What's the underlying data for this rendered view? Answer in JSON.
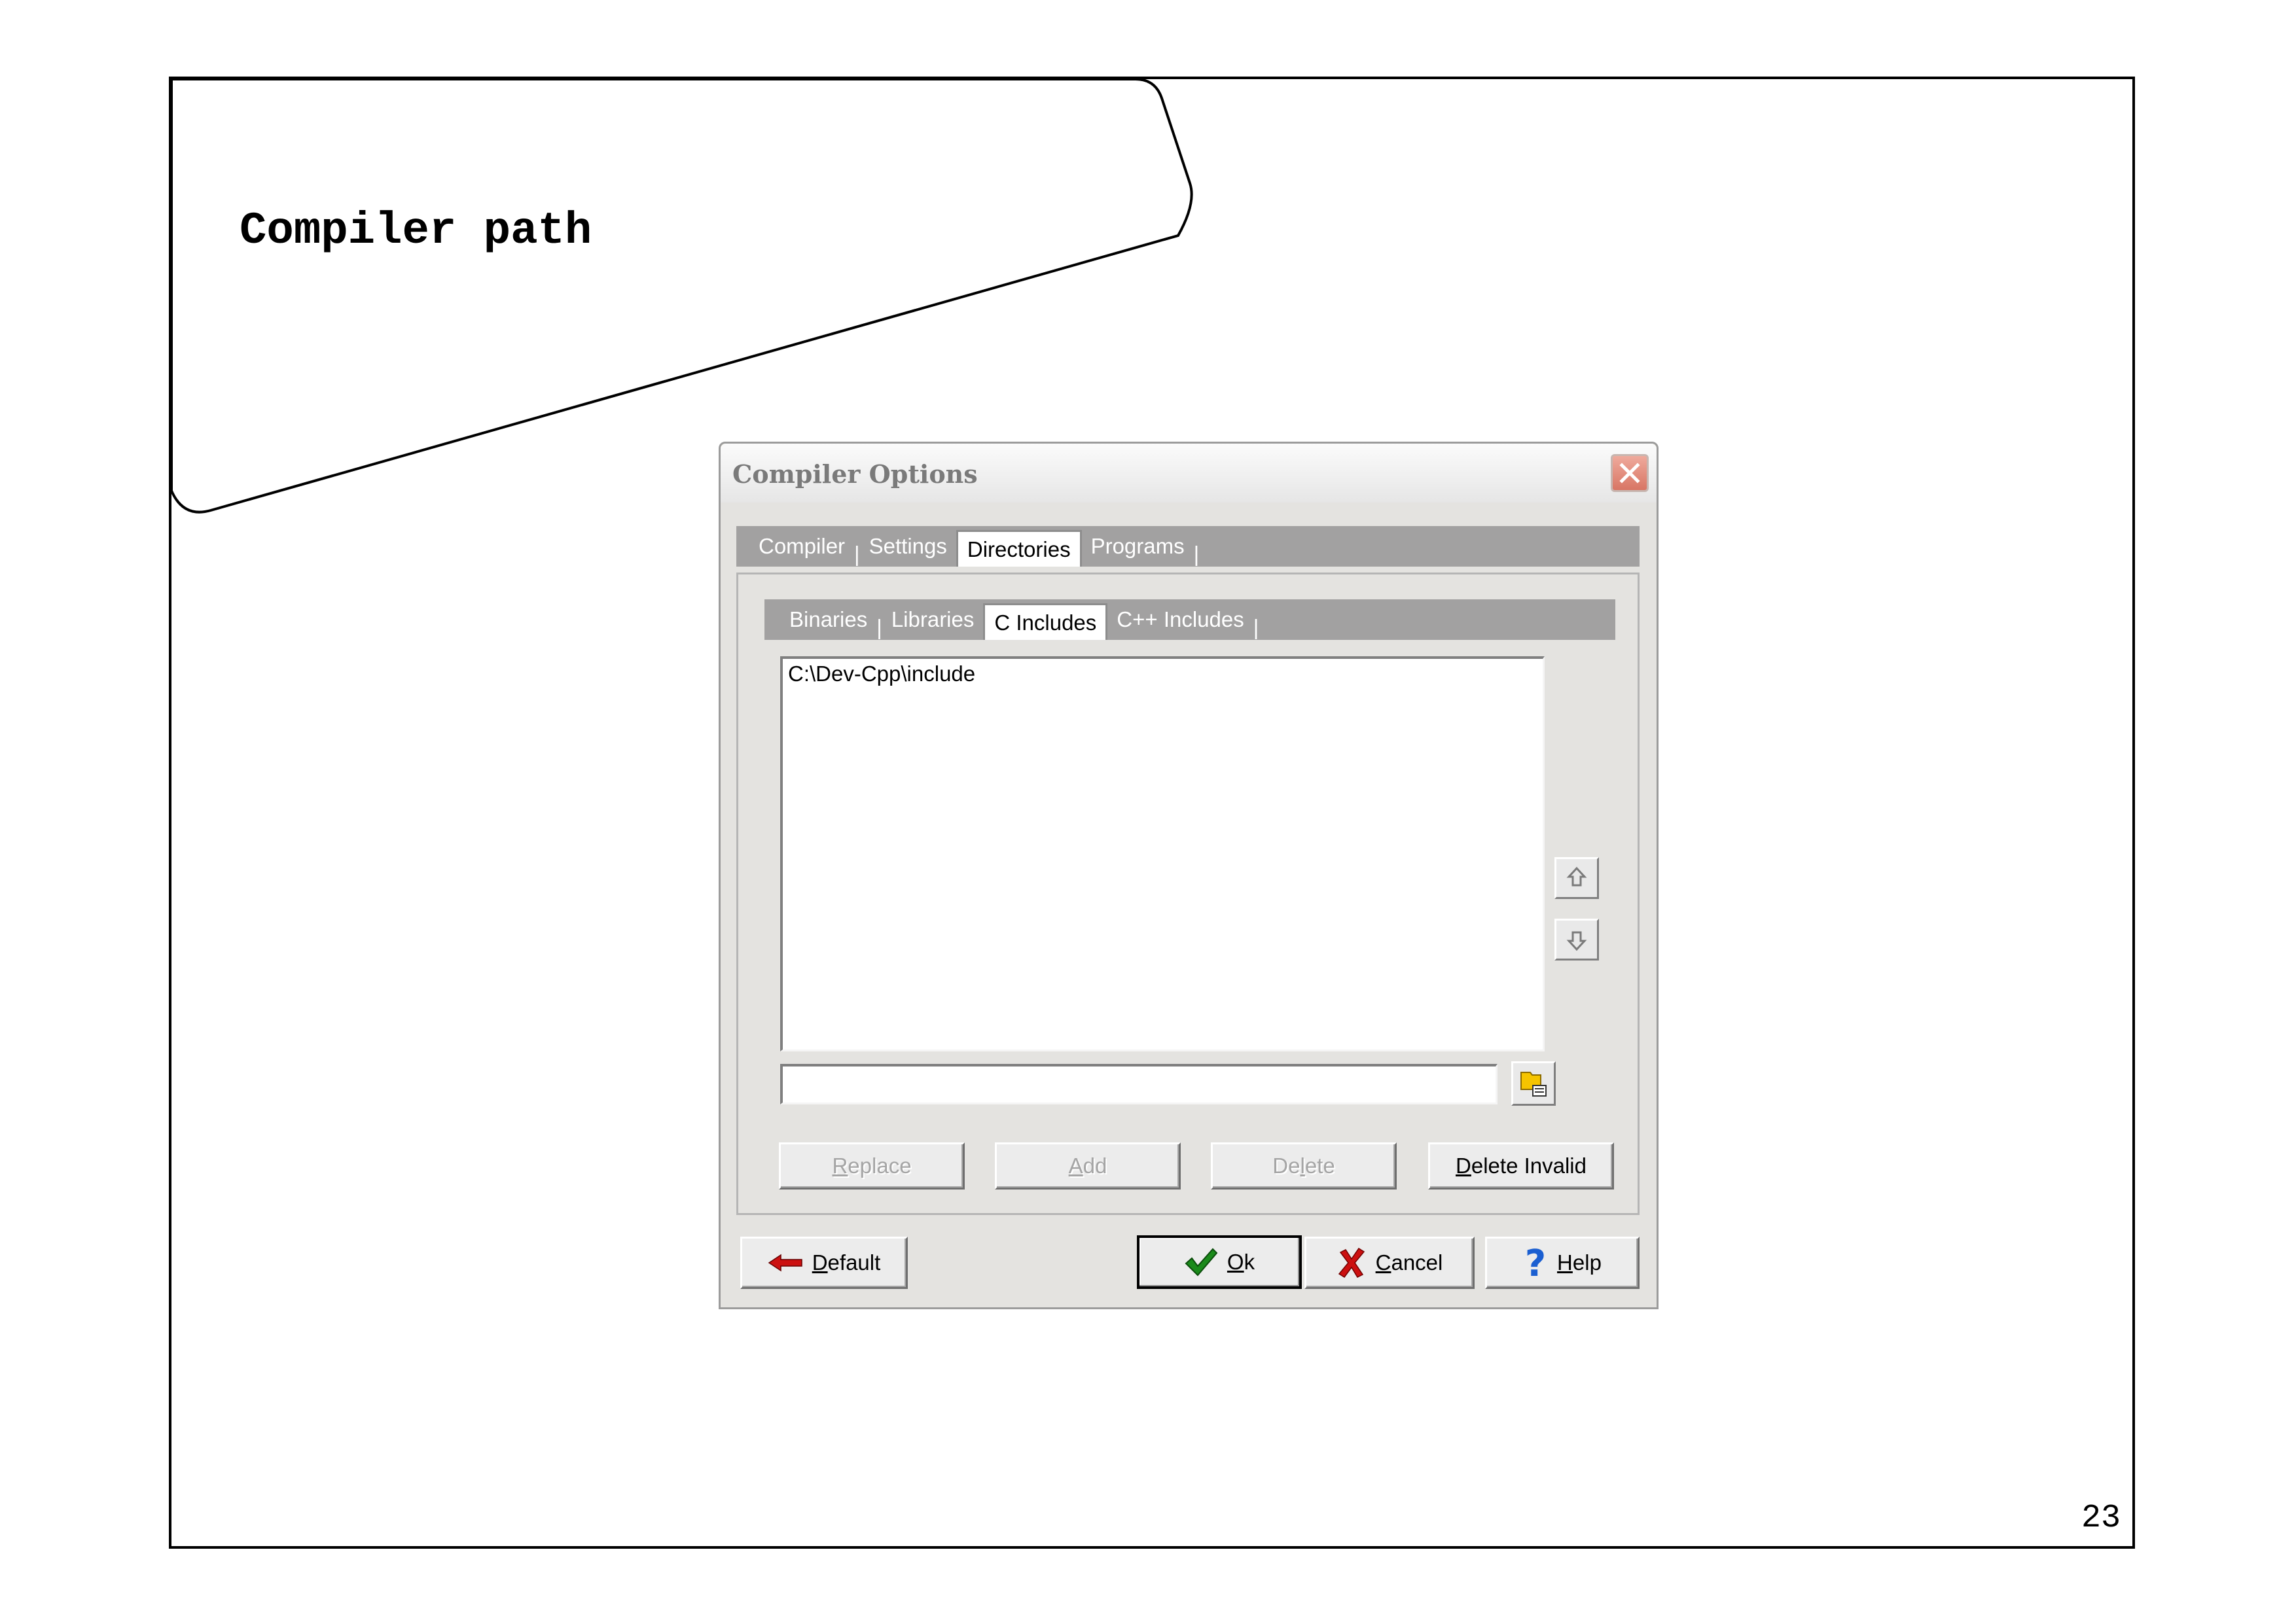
{
  "slide": {
    "title": "Compiler path",
    "page_number": "23"
  },
  "dialog": {
    "title": "Compiler Options",
    "main_tabs": [
      {
        "label": "Compiler"
      },
      {
        "label": "Settings"
      },
      {
        "label": "Directories",
        "active": true
      },
      {
        "label": "Programs"
      }
    ],
    "sub_tabs": [
      {
        "label": "Binaries"
      },
      {
        "label": "Libraries"
      },
      {
        "label": "C Includes",
        "active": true
      },
      {
        "label": "C++ Includes"
      }
    ],
    "directory_list": [
      "C:\\Dev-Cpp\\include"
    ],
    "path_input": {
      "value": "",
      "placeholder": ""
    },
    "buttons": {
      "replace": {
        "pre": "",
        "key": "R",
        "post": "eplace",
        "enabled": false
      },
      "add": {
        "pre": "",
        "key": "A",
        "post": "dd",
        "enabled": false
      },
      "delete": {
        "pre": "De",
        "key": "l",
        "post": "ete",
        "enabled": false
      },
      "delete_invalid": {
        "pre": "",
        "key": "D",
        "post": "elete Invalid",
        "enabled": true
      },
      "default": {
        "pre": "",
        "key": "D",
        "post": "efault"
      },
      "ok": {
        "pre": "",
        "key": "O",
        "post": "k"
      },
      "cancel": {
        "pre": "",
        "key": "C",
        "post": "ancel"
      },
      "help": {
        "pre": "",
        "key": "H",
        "post": "elp"
      }
    },
    "icons": {
      "close": "close-icon",
      "move_up": "arrow-up-icon",
      "move_down": "arrow-down-icon",
      "browse": "folder-browse-icon",
      "default": "red-arrow-left-icon",
      "ok": "green-check-icon",
      "cancel": "red-x-icon",
      "help": "blue-question-icon"
    }
  },
  "colors": {
    "tab_strip": "#a2a1a1",
    "dialog_background": "#e4e3e0",
    "close_button": "#d87664"
  }
}
